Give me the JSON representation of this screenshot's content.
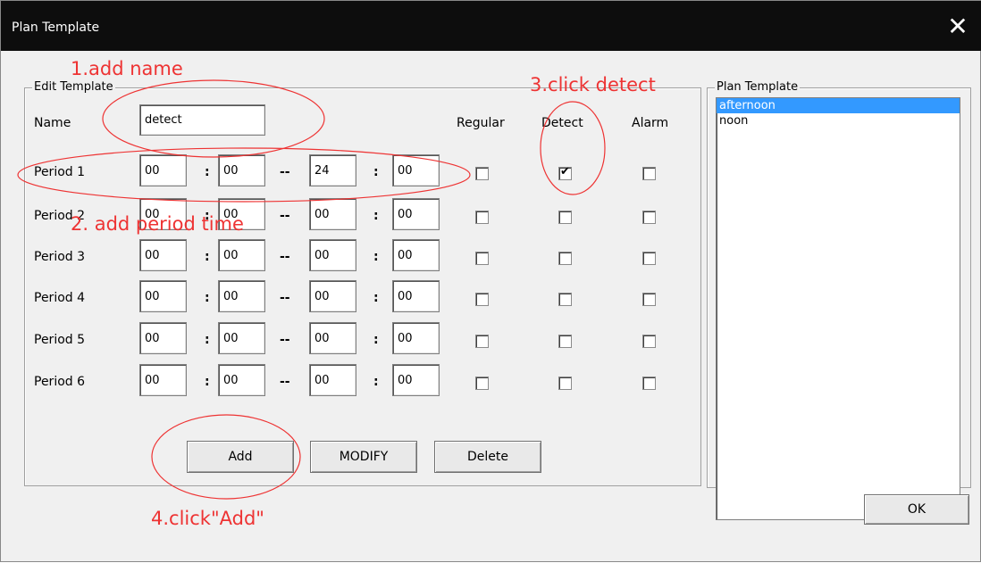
{
  "window": {
    "title": "Plan Template",
    "close_glyph": "✕"
  },
  "edit_group": {
    "legend": "Edit Template"
  },
  "name_field": {
    "label": "Name",
    "value": "detect"
  },
  "columns": {
    "regular": "Regular",
    "detect": "Detect",
    "alarm": "Alarm"
  },
  "separators": {
    "colon": ":",
    "dash": "--"
  },
  "periods": [
    {
      "label": "Period 1",
      "start_h": "00",
      "start_m": "00",
      "end_h": "24",
      "end_m": "00",
      "regular": false,
      "detect": true,
      "alarm": false
    },
    {
      "label": "Period 2",
      "start_h": "00",
      "start_m": "00",
      "end_h": "00",
      "end_m": "00",
      "regular": false,
      "detect": false,
      "alarm": false
    },
    {
      "label": "Period 3",
      "start_h": "00",
      "start_m": "00",
      "end_h": "00",
      "end_m": "00",
      "regular": false,
      "detect": false,
      "alarm": false
    },
    {
      "label": "Period 4",
      "start_h": "00",
      "start_m": "00",
      "end_h": "00",
      "end_m": "00",
      "regular": false,
      "detect": false,
      "alarm": false
    },
    {
      "label": "Period 5",
      "start_h": "00",
      "start_m": "00",
      "end_h": "00",
      "end_m": "00",
      "regular": false,
      "detect": false,
      "alarm": false
    },
    {
      "label": "Period 6",
      "start_h": "00",
      "start_m": "00",
      "end_h": "00",
      "end_m": "00",
      "regular": false,
      "detect": false,
      "alarm": false
    }
  ],
  "buttons": {
    "add": "Add",
    "modify": "MODIFY",
    "delete": "Delete",
    "ok": "OK"
  },
  "plan_group": {
    "legend": "Plan Template",
    "items": [
      {
        "label": "afternoon",
        "selected": true
      },
      {
        "label": "noon",
        "selected": false
      }
    ]
  },
  "annotations": {
    "step1": "1.add name",
    "step2": "2. add period time",
    "step3": "3.click detect",
    "step4": "4.click\"Add\"",
    "color": "#ee3333"
  },
  "colors": {
    "titlebar": "#0d0d0d",
    "selection": "#3399ff",
    "dialog_bg": "#f0f0f0"
  }
}
